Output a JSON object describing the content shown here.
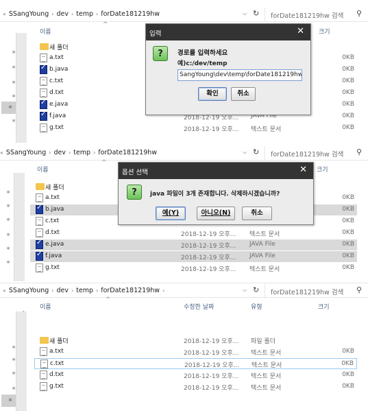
{
  "panels": [
    {
      "breadcrumb": [
        "SSangYoung",
        "dev",
        "temp",
        "forDate181219hw"
      ],
      "search_placeholder": "forDate181219hw 검색",
      "headers": {
        "name": "이름",
        "size": "크기"
      },
      "rows": [
        {
          "name": "새 폴더",
          "icon": "folder",
          "date": "",
          "type": "",
          "size": ""
        },
        {
          "name": "a.txt",
          "icon": "txt",
          "date": "",
          "type": "",
          "size": "0KB"
        },
        {
          "name": "b.java",
          "icon": "java",
          "date": "",
          "type": "",
          "size": "0KB"
        },
        {
          "name": "c.txt",
          "icon": "txt",
          "date": "",
          "type": "",
          "size": "0KB"
        },
        {
          "name": "d.txt",
          "icon": "txt",
          "date": "",
          "type": "",
          "size": "0KB"
        },
        {
          "name": "e.java",
          "icon": "java",
          "date": "",
          "type": "",
          "size": "0KB"
        },
        {
          "name": "f.java",
          "icon": "java",
          "date": "2018-12-19 오후...",
          "type": "JAVA File",
          "size": "0KB"
        },
        {
          "name": "g.txt",
          "icon": "txt",
          "date": "2018-12-19 오후...",
          "type": "텍스트 문서",
          "size": "0KB"
        }
      ],
      "dialog": {
        "title": "입력",
        "message": "경로를 입력하세요",
        "example": "예)c:/dev/temp",
        "input_value": "SangYoung\\dev\\temp\\forDate181219hw",
        "ok": "확인",
        "cancel": "취소"
      }
    },
    {
      "breadcrumb": [
        "SSangYoung",
        "dev",
        "temp",
        "forDate181219hw"
      ],
      "search_placeholder": "forDate181219hw 검색",
      "headers": {
        "name": "이름",
        "size": "크기"
      },
      "rows": [
        {
          "name": "새 폴더",
          "icon": "folder",
          "date": "",
          "type": "",
          "size": ""
        },
        {
          "name": "a.txt",
          "icon": "txt",
          "date": "",
          "type": "",
          "size": "0KB"
        },
        {
          "name": "b.java",
          "icon": "java",
          "date": "",
          "type": "",
          "size": "0KB",
          "hl": true
        },
        {
          "name": "c.txt",
          "icon": "txt",
          "date": "",
          "type": "",
          "size": "0KB"
        },
        {
          "name": "d.txt",
          "icon": "txt",
          "date": "2018-12-19 오후...",
          "type": "텍스트 문서",
          "size": "0KB"
        },
        {
          "name": "e.java",
          "icon": "java",
          "date": "2018-12-19 오후...",
          "type": "JAVA File",
          "size": "0KB",
          "hl": true
        },
        {
          "name": "f.java",
          "icon": "java",
          "date": "2018-12-19 오후...",
          "type": "JAVA File",
          "size": "0KB",
          "hl": true
        },
        {
          "name": "g.txt",
          "icon": "txt",
          "date": "2018-12-19 오후...",
          "type": "텍스트 문서",
          "size": "0KB"
        }
      ],
      "dialog": {
        "title": "옵션 선택",
        "message": "java 파일이 3개 존재합니다. 삭제하시겠습니까?",
        "yes": "예(Y)",
        "no": "아니오(N)",
        "cancel": "취소"
      }
    },
    {
      "breadcrumb": [
        "SSangYoung",
        "dev",
        "temp",
        "forDate181219hw"
      ],
      "search_placeholder": "forDate181219hw 검색",
      "headers": {
        "name": "이름",
        "date": "수정한 날짜",
        "type": "유형",
        "size": "크기"
      },
      "rows": [
        {
          "name": "새 폴더",
          "icon": "folder",
          "date": "2018-12-19 오후...",
          "type": "파일 폴더",
          "size": ""
        },
        {
          "name": "a.txt",
          "icon": "txt",
          "date": "2018-12-19 오후...",
          "type": "텍스트 문서",
          "size": "0KB"
        },
        {
          "name": "c.txt",
          "icon": "txt",
          "date": "2018-12-19 오후...",
          "type": "텍스트 문서",
          "size": "0KB",
          "focus": true
        },
        {
          "name": "d.txt",
          "icon": "txt",
          "date": "2018-12-19 오후...",
          "type": "텍스트 문서",
          "size": "0KB"
        },
        {
          "name": "g.txt",
          "icon": "txt",
          "date": "2018-12-19 오후...",
          "type": "텍스트 문서",
          "size": "0KB"
        }
      ]
    }
  ]
}
